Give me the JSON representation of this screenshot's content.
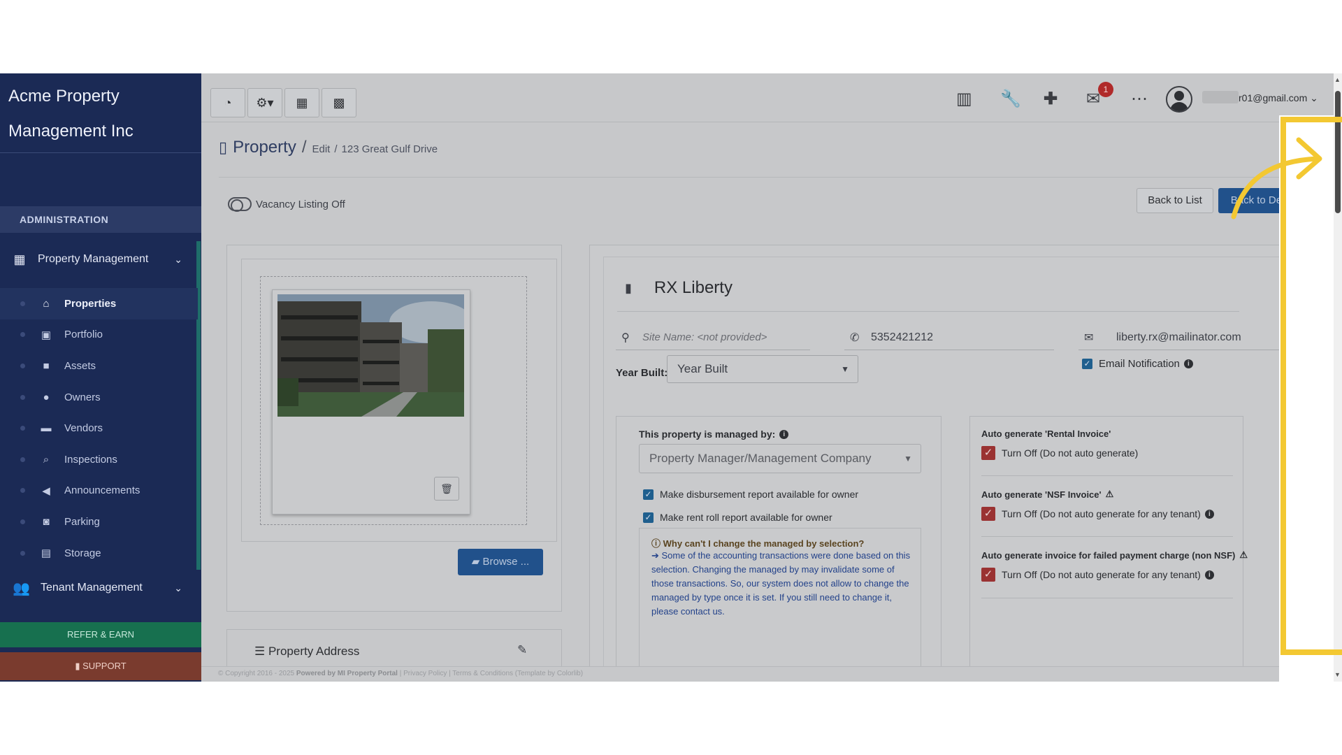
{
  "sidebar": {
    "brand": "Acme Property Management Inc",
    "admin_label": "ADMINISTRATION",
    "property_management": "Property Management",
    "items": [
      {
        "label": "Properties",
        "icon": "home-icon"
      },
      {
        "label": "Portfolio",
        "icon": "portfolio-icon"
      },
      {
        "label": "Assets",
        "icon": "assets-icon"
      },
      {
        "label": "Owners",
        "icon": "user-icon"
      },
      {
        "label": "Vendors",
        "icon": "briefcase-icon"
      },
      {
        "label": "Inspections",
        "icon": "search-icon"
      },
      {
        "label": "Announcements",
        "icon": "bullhorn-icon"
      },
      {
        "label": "Parking",
        "icon": "car-icon"
      },
      {
        "label": "Storage",
        "icon": "basket-icon"
      }
    ],
    "tenant_management": "Tenant Management",
    "refer_label": "REFER & EARN",
    "support_label": "SUPPORT"
  },
  "topbar": {
    "mail_badge": "1",
    "user_email": "r01@gmail.com"
  },
  "breadcrumb": {
    "title": "Property",
    "sep": "/",
    "edit": "Edit",
    "sep2": "/",
    "address": "123 Great Gulf Drive"
  },
  "actions": {
    "vacancy_label": "Vacancy Listing Off",
    "back_to_list": "Back to List",
    "back_to_detail": "Back to Detail"
  },
  "image_panel": {
    "browse_label": "Browse ...",
    "address_section": "Property Address"
  },
  "property": {
    "name": "RX Liberty",
    "site_name_placeholder": "Site Name: <not provided>",
    "phone": "5352421212",
    "email": "liberty.rx@mailinator.com",
    "year_built_label": "Year Built:",
    "year_built_value": "Year Built",
    "email_notification": "Email Notification"
  },
  "managed": {
    "label": "This property is managed by:",
    "select_value": "Property Manager/Management Company",
    "cb1": "Make disbursement report available for owner",
    "cb2": "Make rent roll report available for owner",
    "why_title": "Why can't I change the managed by selection?",
    "why_text": "Some of the accounting transactions were done based on this selection. Changing the managed by may invalidate some of those transactions. So, our system does not allow to change the managed by type once it is set. If you still need to change it, please contact us."
  },
  "auto": {
    "rental_label": "Auto generate 'Rental Invoice'",
    "rental_opt": "Turn Off (Do not auto generate)",
    "nsf_label": "Auto generate 'NSF Invoice'",
    "nsf_opt": "Turn Off (Do not auto generate for any tenant)",
    "failed_label": "Auto generate invoice for failed payment charge (non NSF)",
    "failed_opt": "Turn Off (Do not auto generate for any tenant)"
  },
  "footer": {
    "copyright": "© Copyright 2016 - 2025",
    "powered": "Powered by MI Property Portal",
    "links": "| Privacy Policy | Terms & Conditions",
    "template": "(Template by Colorlib)"
  },
  "colors": {
    "sidebar": "#1b2a55",
    "primary_button": "#21518b",
    "highlight": "#f3c832",
    "refer": "#17704f",
    "support": "#7a3b2e"
  }
}
